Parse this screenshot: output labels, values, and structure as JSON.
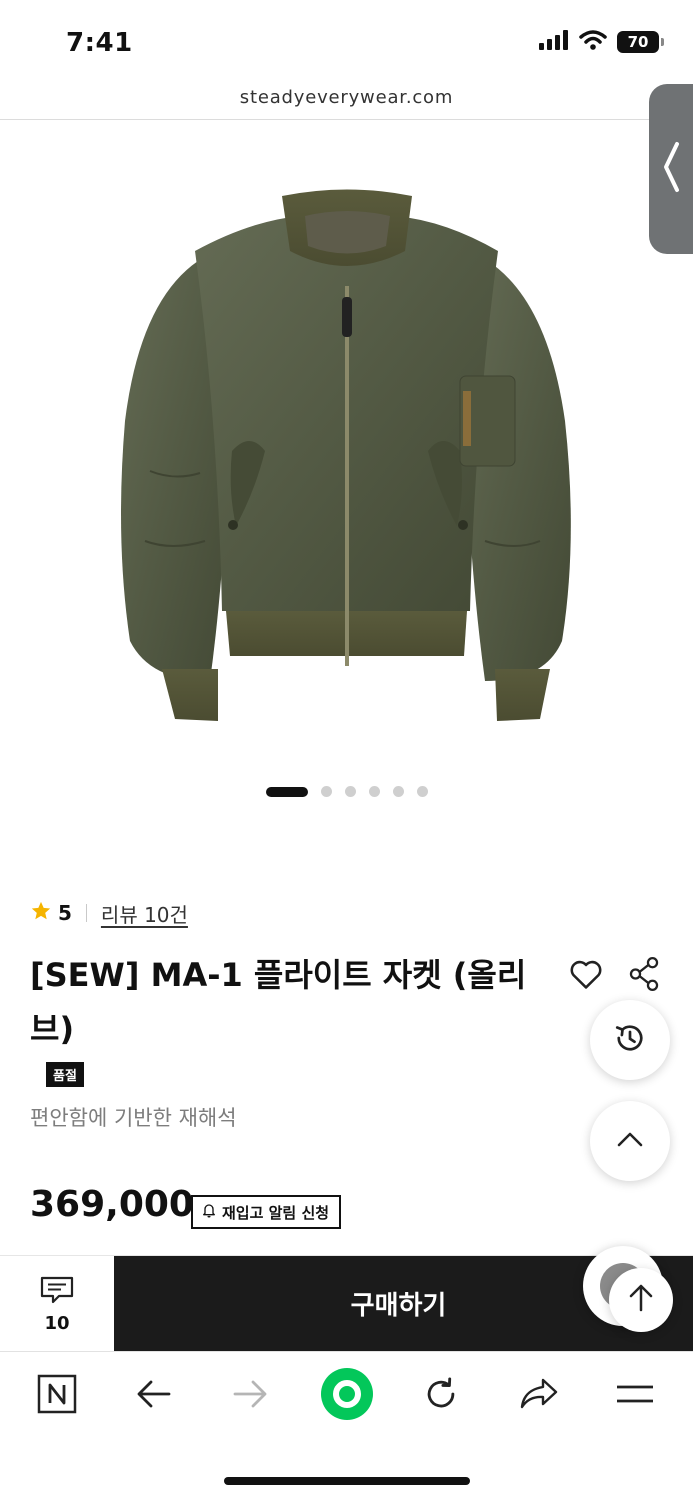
{
  "status_bar": {
    "time": "7:41",
    "battery": "70"
  },
  "browser": {
    "url": "steadyeverywear.com"
  },
  "carousel": {
    "total": 6,
    "active_index": 1
  },
  "product": {
    "rating": "5",
    "review_link": "리뷰 10건",
    "title": "[SEW] MA-1 플라이트 자켓 (올리브)",
    "soldout_badge": "품절",
    "subtitle": "편안함에 기반한 재해석",
    "price": "369,000",
    "restock_label": "재입고 알림 신청"
  },
  "action_bar": {
    "comment_count": "10",
    "buy_label": "구매하기"
  },
  "colors": {
    "star": "#f5b400",
    "buy_bg": "#1b1b1b",
    "home_button": "#03c75a",
    "jacket": "#555c46"
  },
  "icons": [
    "signal-icon",
    "wifi-icon",
    "battery-icon",
    "chevron-left-icon",
    "star-icon",
    "heart-icon",
    "share-icon",
    "history-icon",
    "chevron-up-icon",
    "arrow-up-icon",
    "bell-icon",
    "comment-icon",
    "naver-n-icon",
    "back-arrow-icon",
    "forward-arrow-icon",
    "home-dot-icon",
    "refresh-icon",
    "share-arrow-icon",
    "menu-icon"
  ]
}
